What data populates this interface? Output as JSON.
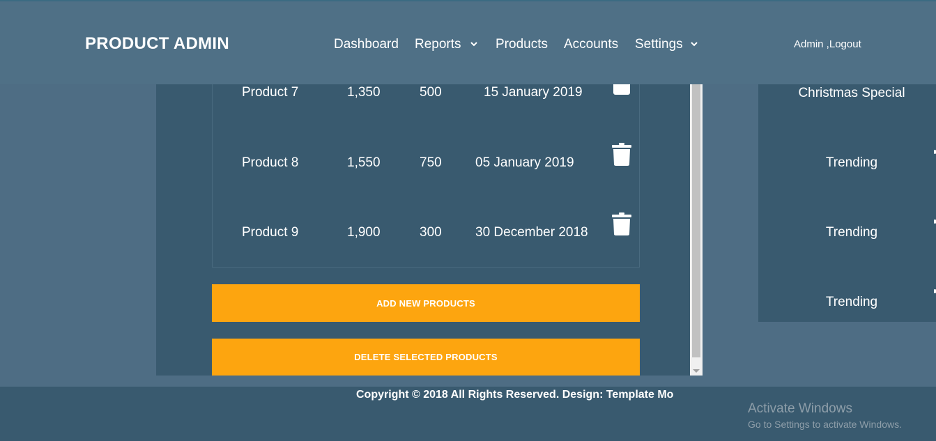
{
  "header": {
    "brand": "PRODUCT ADMIN",
    "nav": [
      {
        "label": "Dashboard",
        "icon": ""
      },
      {
        "label": "Reports",
        "icon": "chevron-down-icon"
      },
      {
        "label": "Products",
        "icon": ""
      },
      {
        "label": "Accounts",
        "icon": ""
      },
      {
        "label": "Settings",
        "icon": "chevron-down-icon"
      }
    ],
    "account": "Admin ,Logout"
  },
  "products": {
    "rows": [
      {
        "name": "Product 7",
        "sold": "1,350",
        "in_stock": "500",
        "expire_date": "15 January 2019",
        "icon": "trash-icon"
      },
      {
        "name": "Product 8",
        "sold": "1,550",
        "in_stock": "750",
        "expire_date": "05 January 2019",
        "icon": "trash-icon"
      },
      {
        "name": "Product 9",
        "sold": "1,900",
        "in_stock": "300",
        "expire_date": "30 December 2018",
        "icon": "trash-icon"
      }
    ],
    "add_button": "ADD NEW PRODUCTS",
    "delete_button": "DELETE SELECTED PRODUCTS"
  },
  "categories": {
    "items": [
      "Christmas Special",
      "Trending",
      "Trending",
      "Trending"
    ]
  },
  "footer": {
    "copyright": "Copyright © 2018 All Rights Reserved. Design: Template Mo"
  },
  "watermark": {
    "title": "Activate Windows",
    "subtitle": "Go to Settings to activate Windows."
  },
  "colors": {
    "accent": "#fda50f",
    "header_bg": "#4f7086",
    "panel_bg": "#395a6f",
    "page_bg": "#4e6d84"
  }
}
